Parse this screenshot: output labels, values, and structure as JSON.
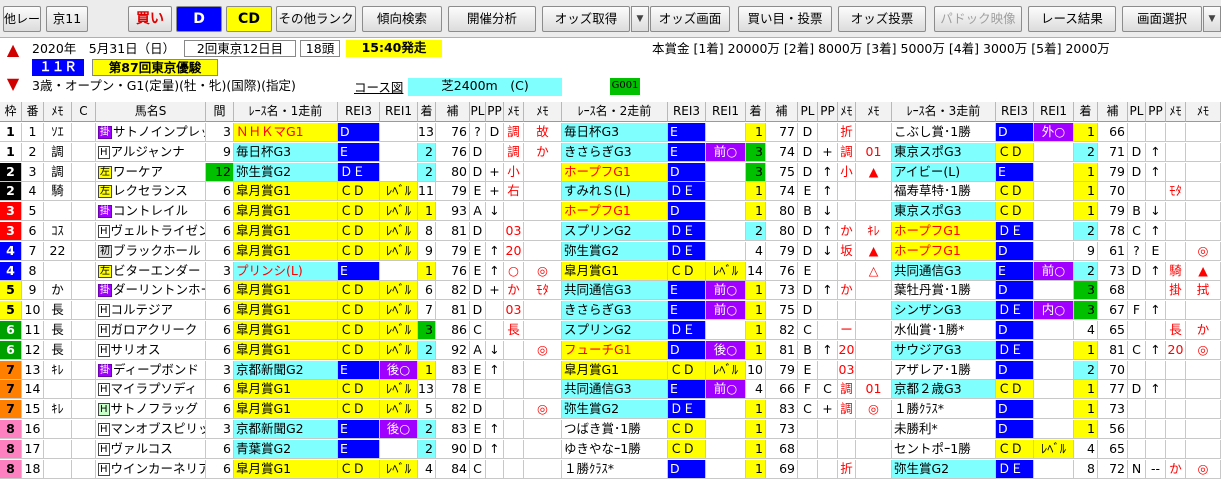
{
  "toolbar": {
    "buttons": [
      {
        "id": "other-race",
        "label": "他レース",
        "style": ""
      },
      {
        "id": "venue",
        "label": "京11",
        "style": ""
      },
      {
        "id": "buy",
        "label": "買い",
        "style": "red"
      },
      {
        "id": "mark-d",
        "label": "D",
        "style": "blue"
      },
      {
        "id": "mark-cd",
        "label": "CD",
        "style": "yel"
      },
      {
        "id": "other-rank",
        "label": "その他ランク",
        "style": ""
      },
      {
        "id": "trend-search",
        "label": "傾向検索",
        "style": ""
      },
      {
        "id": "meeting-analysis",
        "label": "開催分析",
        "style": ""
      },
      {
        "id": "odds-fetch",
        "label": "オッズ取得",
        "style": ""
      },
      {
        "id": "odds-screen",
        "label": "オッズ画面",
        "style": ""
      },
      {
        "id": "bet-buy",
        "label": "買い目・投票",
        "style": ""
      },
      {
        "id": "odds-vote",
        "label": "オッズ投票",
        "style": ""
      },
      {
        "id": "paddock-video",
        "label": "パドック映像",
        "style": "gray"
      },
      {
        "id": "race-result",
        "label": "レース結果",
        "style": ""
      },
      {
        "id": "screen-select",
        "label": "画面選択",
        "style": ""
      }
    ],
    "dropdown_icon": "triangle-down-icon"
  },
  "race": {
    "date": "2020年　5月31日（日）",
    "meeting": "2回東京12日目",
    "field": "18頭",
    "post_time": "15:40発走",
    "race_no": "１１Ｒ",
    "race_name": "第87回東京優駿",
    "conditions": "3歳・オープン・G1(定量)(牡・牝)(国際)(指定)",
    "course_label": "コース図",
    "course": "芝2400m　(C)",
    "code": "G001",
    "prize": "本賞金 [1着] 20000万 [2着] 8000万 [3着] 5000万 [4着] 3000万 [5着] 2000万",
    "up_icon": "arrow-up-icon",
    "down_icon": "arrow-down-icon"
  },
  "headers": [
    "枠",
    "番",
    "ﾒﾓ",
    "C",
    "馬名S",
    "間",
    "ﾚｰｽ名・1走前",
    "REI3",
    "REI1",
    "着",
    "補",
    "PL",
    "PP",
    "ﾒﾓ",
    "ﾒﾓ",
    "ﾚｰｽ名・2走前",
    "REI3",
    "REI1",
    "着",
    "補",
    "PL",
    "PP",
    "ﾒﾓ",
    "ﾒﾓ",
    "ﾚｰｽ名・3走前",
    "REI3",
    "REI1",
    "着",
    "補",
    "PL",
    "PP",
    "ﾒﾓ",
    "ﾒﾓ"
  ],
  "colors": {
    "w1": "#ffffff",
    "w2": "#000000",
    "w3": "#ff0000",
    "w4": "#0000ff",
    "w5": "#ffff00",
    "w6": "#00a000",
    "w7": "#ff8000",
    "w8": "#ff80c0",
    "cyan": "#80ffff",
    "blue": "#0000ff",
    "yellow": "#ffff00",
    "green": "#00c000",
    "red": "#ff0000",
    "purple": "#a000ff"
  },
  "rows": [
    {
      "w": "1",
      "n": "1",
      "m": "ｿｴ",
      "hs": "掛",
      "hb": "p",
      "h": "サトノインプレッサ",
      "k": "3",
      "a": [
        "ＮＨＫマG1",
        "D",
        "",
        "13",
        "76",
        "?",
        "D",
        "調",
        "故"
      ],
      "b": [
        "毎日杯G3",
        "E",
        "",
        "1",
        "77",
        "D",
        "",
        "折",
        ""
      ],
      "c": [
        "こぶし賞･1勝",
        "D",
        "外○",
        "1",
        "66",
        "",
        "",
        "",
        ""
      ]
    },
    {
      "w": "1",
      "n": "2",
      "m": "調",
      "hs": "H",
      "hb": "",
      "h": "アルジャンナ",
      "k": "9",
      "a": [
        "毎日杯G3",
        "E",
        "",
        "2",
        "76",
        "D",
        "",
        "調",
        "か"
      ],
      "b": [
        "きさらぎG3",
        "E",
        "前○",
        "3",
        "74",
        "D",
        "+",
        "調",
        "01"
      ],
      "c": [
        "東京スポG3",
        "ＣＤ",
        "",
        "2",
        "71",
        "D",
        "↑",
        "",
        ""
      ]
    },
    {
      "w": "2",
      "n": "3",
      "m": "調",
      "hs": "左",
      "hb": "y",
      "h": "ワーケア",
      "k": "12",
      "a": [
        "弥生賞G2",
        "ＤＥ",
        "",
        "2",
        "80",
        "D",
        "+",
        "小",
        ""
      ],
      "b": [
        "ホープフG1",
        "D",
        "",
        "3",
        "75",
        "D",
        "↑",
        "小",
        "▲"
      ],
      "c": [
        "アイビー(L)",
        "E",
        "",
        "1",
        "79",
        "D",
        "↑",
        "",
        ""
      ]
    },
    {
      "w": "2",
      "n": "4",
      "m": "騎",
      "hs": "左",
      "hb": "y",
      "h": "レクセランス",
      "k": "6",
      "a": [
        "皐月賞G1",
        "ＣＤ",
        "ﾚﾍﾞﾙ",
        "11",
        "79",
        "E",
        "+",
        "右",
        ""
      ],
      "b": [
        "すみれＳ(L)",
        "ＤＥ",
        "",
        "1",
        "74",
        "E",
        "↑",
        "",
        ""
      ],
      "c": [
        "福寿草特･1勝",
        "ＣＤ",
        "",
        "1",
        "70",
        "",
        "",
        "ﾓﾀ",
        ""
      ]
    },
    {
      "w": "3",
      "n": "5",
      "m": "",
      "hs": "掛",
      "hb": "p",
      "h": "コントレイル",
      "k": "6",
      "a": [
        "皐月賞G1",
        "ＣＤ",
        "ﾚﾍﾞﾙ",
        "1",
        "93",
        "A",
        "↓",
        "",
        ""
      ],
      "b": [
        "ホープフG1",
        "D",
        "",
        "1",
        "80",
        "B",
        "↓",
        "",
        ""
      ],
      "c": [
        "東京スポG3",
        "ＣＤ",
        "",
        "1",
        "79",
        "B",
        "↓",
        "",
        ""
      ]
    },
    {
      "w": "3",
      "n": "6",
      "m": "ｺｽ",
      "hs": "H",
      "hb": "",
      "h": "ヴェルトライゼンデ",
      "k": "6",
      "a": [
        "皐月賞G1",
        "ＣＤ",
        "ﾚﾍﾞﾙ",
        "8",
        "81",
        "D",
        "",
        "03",
        ""
      ],
      "b": [
        "スプリンG2",
        "ＤＥ",
        "",
        "2",
        "80",
        "D",
        "↑",
        "か",
        "ｷﾚ"
      ],
      "c": [
        "ホープフG1",
        "ＤＥ",
        "",
        "2",
        "78",
        "C",
        "↑",
        "",
        ""
      ]
    },
    {
      "w": "4",
      "n": "7",
      "m": "22",
      "hs": "初",
      "hb": "o",
      "h": "ブラックホール",
      "k": "6",
      "a": [
        "皐月賞G1",
        "ＣＤ",
        "ﾚﾍﾞﾙ",
        "9",
        "79",
        "E",
        "↑",
        "20",
        ""
      ],
      "b": [
        "弥生賞G2",
        "ＤＥ",
        "",
        "4",
        "79",
        "D",
        "↓",
        "坂",
        "▲"
      ],
      "c": [
        "ホープフG1",
        "D",
        "",
        "9",
        "61",
        "?",
        "E",
        "",
        "◎"
      ]
    },
    {
      "w": "4",
      "n": "8",
      "m": "",
      "hs": "左",
      "hb": "y",
      "h": "ビターエンダー",
      "k": "3",
      "a": [
        "プリンシ(L)",
        "E",
        "",
        "1",
        "76",
        "E",
        "↑",
        "○",
        "◎"
      ],
      "b": [
        "皐月賞G1",
        "ＣＤ",
        "ﾚﾍﾞﾙ",
        "14",
        "76",
        "E",
        "",
        "",
        "△"
      ],
      "c": [
        "共同通信G3",
        "E",
        "前○",
        "2",
        "73",
        "D",
        "↑",
        "騎",
        "▲"
      ]
    },
    {
      "w": "5",
      "n": "9",
      "m": "か",
      "hs": "掛",
      "hb": "p",
      "h": "ダーリントンホール",
      "k": "6",
      "a": [
        "皐月賞G1",
        "ＣＤ",
        "ﾚﾍﾞﾙ",
        "6",
        "82",
        "D",
        "+",
        "か",
        "ﾓﾀ"
      ],
      "b": [
        "共同通信G3",
        "E",
        "前○",
        "1",
        "73",
        "D",
        "↑",
        "か",
        ""
      ],
      "c": [
        "葉牡丹賞･1勝",
        "D",
        "",
        "3",
        "68",
        "",
        "",
        "掛",
        "拭"
      ]
    },
    {
      "w": "5",
      "n": "10",
      "m": "長",
      "hs": "H",
      "hb": "",
      "h": "コルテジア",
      "k": "6",
      "a": [
        "皐月賞G1",
        "ＣＤ",
        "ﾚﾍﾞﾙ",
        "7",
        "81",
        "D",
        "",
        "03",
        ""
      ],
      "b": [
        "きさらぎG3",
        "E",
        "前○",
        "1",
        "75",
        "D",
        "",
        "",
        ""
      ],
      "c": [
        "シンザンG3",
        "ＤＥ",
        "内○",
        "3",
        "67",
        "F",
        "↑",
        "",
        ""
      ]
    },
    {
      "w": "6",
      "n": "11",
      "m": "長",
      "hs": "H",
      "hb": "",
      "h": "ガロアクリーク",
      "k": "6",
      "a": [
        "皐月賞G1",
        "ＣＤ",
        "ﾚﾍﾞﾙ",
        "3",
        "86",
        "C",
        "",
        "長",
        ""
      ],
      "b": [
        "スプリンG2",
        "ＤＥ",
        "",
        "1",
        "82",
        "C",
        "",
        "ー",
        ""
      ],
      "c": [
        "水仙賞･1勝*",
        "D",
        "",
        "4",
        "65",
        "",
        "",
        "長",
        "か"
      ]
    },
    {
      "w": "6",
      "n": "12",
      "m": "長",
      "hs": "H",
      "hb": "",
      "h": "サリオス",
      "k": "6",
      "a": [
        "皐月賞G1",
        "ＣＤ",
        "ﾚﾍﾞﾙ",
        "2",
        "92",
        "A",
        "↓",
        "",
        "◎"
      ],
      "b": [
        "フューチG1",
        "D",
        "後○",
        "1",
        "81",
        "B",
        "↑",
        "20",
        ""
      ],
      "c": [
        "サウジアG3",
        "ＤＥ",
        "",
        "1",
        "81",
        "C",
        "↑",
        "20",
        "◎"
      ]
    },
    {
      "w": "7",
      "n": "13",
      "m": "ｷﾚ",
      "hs": "掛",
      "hb": "p",
      "h": "ディープボンド",
      "k": "3",
      "a": [
        "京都新聞G2",
        "E",
        "後○",
        "1",
        "83",
        "E",
        "↑",
        "",
        ""
      ],
      "b": [
        "皐月賞G1",
        "ＣＤ",
        "ﾚﾍﾞﾙ",
        "10",
        "79",
        "E",
        "",
        "03",
        ""
      ],
      "c": [
        "アザレア･1勝",
        "D",
        "",
        "2",
        "70",
        "",
        "",
        "",
        ""
      ]
    },
    {
      "w": "7",
      "n": "14",
      "m": "",
      "hs": "H",
      "hb": "",
      "h": "マイラプソディ",
      "k": "6",
      "a": [
        "皐月賞G1",
        "ＣＤ",
        "ﾚﾍﾞﾙ",
        "13",
        "78",
        "E",
        "",
        "",
        ""
      ],
      "b": [
        "共同通信G3",
        "E",
        "前○",
        "4",
        "66",
        "F",
        "C",
        "調",
        "01"
      ],
      "c": [
        "京都２歳G3",
        "ＣＤ",
        "",
        "1",
        "77",
        "D",
        "↑",
        "",
        ""
      ]
    },
    {
      "w": "7",
      "n": "15",
      "m": "ｷﾚ",
      "hs": "H",
      "hb": "g",
      "h": "サトノフラッグ",
      "k": "6",
      "a": [
        "皐月賞G1",
        "ＣＤ",
        "ﾚﾍﾞﾙ",
        "5",
        "82",
        "D",
        "",
        "",
        "◎"
      ],
      "b": [
        "弥生賞G2",
        "ＤＥ",
        "",
        "1",
        "83",
        "C",
        "+",
        "調",
        "◎"
      ],
      "c": [
        "１勝ｸﾗｽ*",
        "D",
        "",
        "1",
        "73",
        "",
        "",
        "",
        ""
      ]
    },
    {
      "w": "8",
      "n": "16",
      "m": "",
      "hs": "H",
      "hb": "",
      "h": "マンオブスピリット",
      "k": "3",
      "a": [
        "京都新聞G2",
        "E",
        "後○",
        "2",
        "83",
        "E",
        "↑",
        "",
        ""
      ],
      "b": [
        "つばき賞･1勝",
        "ＣＤ",
        "",
        "1",
        "73",
        "",
        "",
        "",
        ""
      ],
      "c": [
        "未勝利*",
        "D",
        "",
        "1",
        "56",
        "",
        "",
        "",
        ""
      ]
    },
    {
      "w": "8",
      "n": "17",
      "m": "",
      "hs": "H",
      "hb": "",
      "h": "ヴァルコス",
      "k": "6",
      "a": [
        "青葉賞G2",
        "E",
        "",
        "2",
        "90",
        "D",
        "↑",
        "",
        ""
      ],
      "b": [
        "ゆきやなｰ1勝",
        "ＣＤ",
        "",
        "1",
        "68",
        "",
        "",
        "",
        ""
      ],
      "c": [
        "セントポｰ1勝",
        "ＣＤ",
        "ﾚﾍﾞﾙ",
        "4",
        "65",
        "",
        "",
        "",
        ""
      ]
    },
    {
      "w": "8",
      "n": "18",
      "m": "",
      "hs": "H",
      "hb": "",
      "h": "ウインカーネリアン",
      "k": "6",
      "a": [
        "皐月賞G1",
        "ＣＤ",
        "ﾚﾍﾞﾙ",
        "4",
        "84",
        "C",
        "",
        "",
        ""
      ],
      "b": [
        "１勝ｸﾗｽ*",
        "D",
        "",
        "1",
        "69",
        "",
        "",
        "折",
        ""
      ],
      "c": [
        "弥生賞G2",
        "ＤＥ",
        "",
        "8",
        "72",
        "N",
        "--",
        "か",
        "◎"
      ]
    }
  ]
}
